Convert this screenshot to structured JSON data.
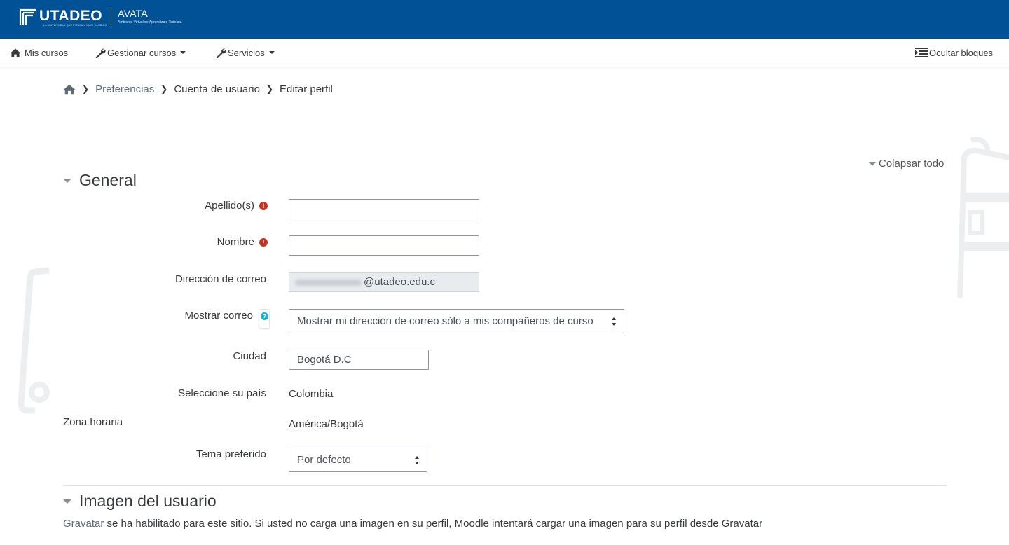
{
  "brand": {
    "name": "UTADEO",
    "tagline": "LA UNIVERSIDAD QUE PIENSA Y HACE CAMBIOS",
    "product": "AVATA",
    "product_sub": "Ambiente Virtual de Aprendizaje Tadeísta",
    "color": "#005196"
  },
  "navbar": {
    "items": [
      {
        "label": "Mis cursos",
        "icon": "home-icon"
      },
      {
        "label": "Gestionar cursos",
        "icon": "wrench-icon",
        "dropdown": true
      },
      {
        "label": "Servicios",
        "icon": "wrench-icon",
        "dropdown": true
      }
    ],
    "hide_blocks": {
      "label": "Ocultar bloques",
      "icon": "indent-icon"
    }
  },
  "breadcrumb": {
    "home_icon": "home-icon",
    "items": [
      "Preferencias",
      "Cuenta de usuario",
      "Editar perfil"
    ]
  },
  "collapse_all": "Colapsar todo",
  "general": {
    "title": "General",
    "fields": {
      "lastname": {
        "label": "Apellido(s)",
        "value": "",
        "required": true
      },
      "firstname": {
        "label": "Nombre",
        "value": "",
        "required": true
      },
      "email": {
        "label": "Dirección de correo",
        "value": "@utadeo.edu.c"
      },
      "maildisplay": {
        "label": "Mostrar correo",
        "value": "Mostrar mi dirección de correo sólo a mis compañeros de curso"
      },
      "city": {
        "label": "Ciudad",
        "value": "Bogotá D.C"
      },
      "country": {
        "label": "Seleccione su país",
        "value": "Colombia"
      },
      "timezone": {
        "label": "Zona horaria",
        "value": "América/Bogotá"
      },
      "theme": {
        "label": "Tema preferido",
        "value": "Por defecto"
      }
    }
  },
  "user_image": {
    "title": "Imagen del usuario",
    "link": "Gravatar",
    "text": " se ha habilitado para este sitio. Si usted no carga una imagen en su perfil, Moodle intentará cargar una imagen para su perfil desde Gravatar"
  },
  "colors": {
    "required": "#ca3120",
    "help": "#1fb0c9",
    "link": "#5e6a75"
  }
}
